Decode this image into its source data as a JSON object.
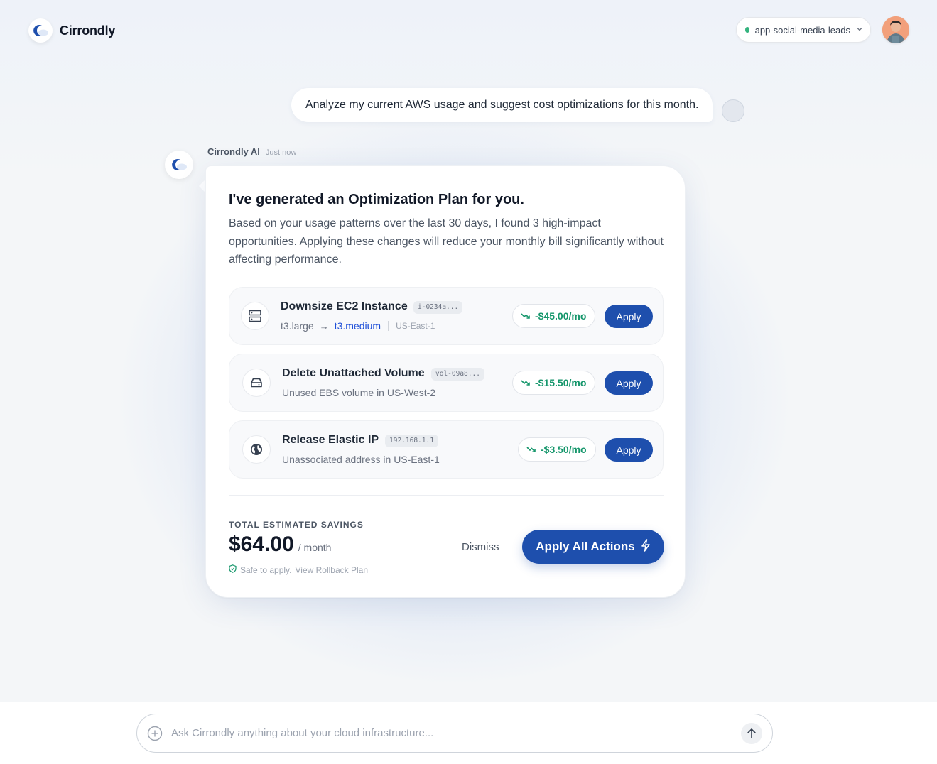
{
  "brand": {
    "name": "Cirrondly"
  },
  "header": {
    "project": "app-social-media-leads"
  },
  "user_message": "Analyze my current AWS usage and suggest cost optimizations for this month.",
  "ai": {
    "name": "Cirrondly AI",
    "time": "Just now"
  },
  "plan": {
    "title": "I've generated an Optimization Plan for you.",
    "description": "Based on your usage patterns over the last 30 days, I found 3 high-impact opportunities. Applying these changes will reduce your monthly bill significantly without affecting performance.",
    "actions": [
      {
        "icon": "server-icon",
        "title": "Downsize EC2 Instance",
        "tag": "i-0234a...",
        "from": "t3.large",
        "to": "t3.medium",
        "region": "US-East-1",
        "saving": "-$45.00/mo",
        "apply": "Apply"
      },
      {
        "icon": "hard-drive-icon",
        "title": "Delete Unattached Volume",
        "tag": "vol-09a8...",
        "subtitle": "Unused EBS volume in US-West-2",
        "saving": "-$15.50/mo",
        "apply": "Apply"
      },
      {
        "icon": "globe-icon",
        "title": "Release Elastic IP",
        "tag": "192.168.1.1",
        "subtitle": "Unassociated address in US-East-1",
        "saving": "-$3.50/mo",
        "apply": "Apply"
      }
    ],
    "total_label": "TOTAL ESTIMATED SAVINGS",
    "total_amount": "$64.00",
    "total_unit": "/ month",
    "safe_text": "Safe to apply.",
    "rollback_link": "View Rollback Plan",
    "dismiss": "Dismiss",
    "apply_all": "Apply All Actions"
  },
  "composer": {
    "placeholder": "Ask Cirrondly anything about your cloud infrastructure..."
  },
  "colors": {
    "accent": "#1e4fad",
    "savings_green": "#15966b",
    "status_green": "#34b37e"
  }
}
